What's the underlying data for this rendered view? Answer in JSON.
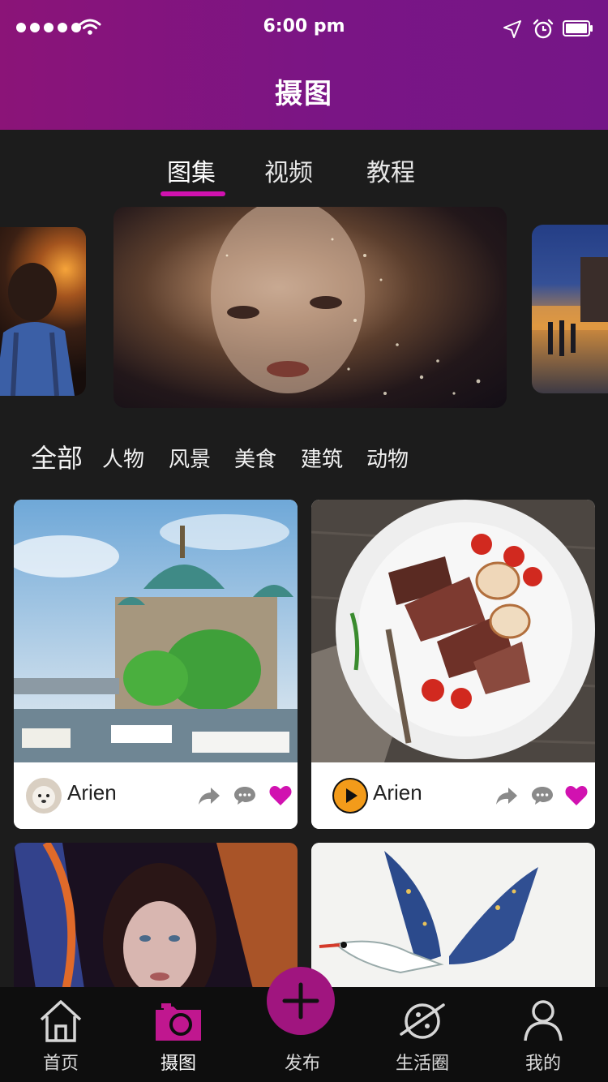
{
  "colors": {
    "header_start": "#8b1478",
    "header_end": "#751687",
    "accent": "#d112b0",
    "publish_fab": "#a0157f",
    "background": "#1c1c1c"
  },
  "status_bar": {
    "time": "6:00 pm",
    "icons": [
      "signal-dots-icon",
      "wifi-icon",
      "location-arrow-icon",
      "alarm-icon",
      "battery-icon"
    ]
  },
  "header": {
    "title": "摄图"
  },
  "tabs": [
    {
      "label": "图集"
    },
    {
      "label": "视频"
    },
    {
      "label": "教程"
    }
  ],
  "active_tab": "图集",
  "categories": [
    {
      "label": "全部"
    },
    {
      "label": "人物"
    },
    {
      "label": "风景"
    },
    {
      "label": "美食"
    },
    {
      "label": "建筑"
    },
    {
      "label": "动物"
    }
  ],
  "active_category": "全部",
  "posts": [
    {
      "author": "Arien",
      "photo": "berlin-cathedral-photo",
      "liked": true
    },
    {
      "author": "Arien",
      "photo": "steak-dinner-photo",
      "liked": true
    },
    {
      "author": "",
      "photo": "neon-portrait-photo"
    },
    {
      "author": "",
      "photo": "painted-crane-photo"
    }
  ],
  "tabbar": {
    "items": [
      {
        "label": "首页",
        "icon": "home-icon"
      },
      {
        "label": "摄图",
        "icon": "camera-icon"
      },
      {
        "label": "发布",
        "icon": "plus-icon"
      },
      {
        "label": "生活圈",
        "icon": "planet-icon"
      },
      {
        "label": "我的",
        "icon": "user-icon"
      }
    ],
    "active": "摄图"
  }
}
